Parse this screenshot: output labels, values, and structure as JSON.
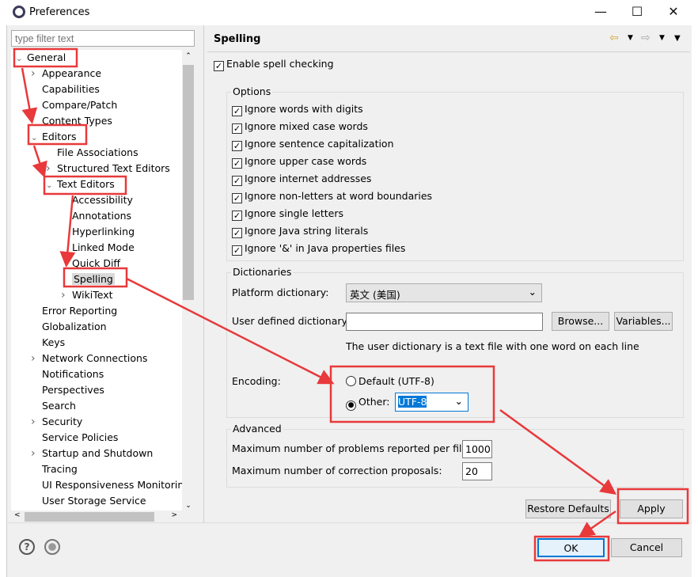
{
  "window": {
    "title": "Preferences",
    "minimize": "—",
    "maximize": "☐",
    "close": "✕"
  },
  "filter": {
    "placeholder": "type filter text"
  },
  "tree": [
    {
      "label": "General",
      "level": 0,
      "twisty": "v"
    },
    {
      "label": "Appearance",
      "level": 1,
      "twisty": ">"
    },
    {
      "label": "Capabilities",
      "level": 1,
      "twisty": ""
    },
    {
      "label": "Compare/Patch",
      "level": 1,
      "twisty": ""
    },
    {
      "label": "Content Types",
      "level": 1,
      "twisty": ""
    },
    {
      "label": "Editors",
      "level": 1,
      "twisty": "v"
    },
    {
      "label": "File Associations",
      "level": 2,
      "twisty": ""
    },
    {
      "label": "Structured Text Editors",
      "level": 2,
      "twisty": ">"
    },
    {
      "label": "Text Editors",
      "level": 2,
      "twisty": "v"
    },
    {
      "label": "Accessibility",
      "level": 3,
      "twisty": ""
    },
    {
      "label": "Annotations",
      "level": 3,
      "twisty": ""
    },
    {
      "label": "Hyperlinking",
      "level": 3,
      "twisty": ""
    },
    {
      "label": "Linked Mode",
      "level": 3,
      "twisty": ""
    },
    {
      "label": "Quick Diff",
      "level": 3,
      "twisty": ""
    },
    {
      "label": "Spelling",
      "level": 3,
      "twisty": "",
      "selected": true
    },
    {
      "label": "WikiText",
      "level": 3,
      "twisty": ">"
    },
    {
      "label": "Error Reporting",
      "level": 1,
      "twisty": ""
    },
    {
      "label": "Globalization",
      "level": 1,
      "twisty": ""
    },
    {
      "label": "Keys",
      "level": 1,
      "twisty": ""
    },
    {
      "label": "Network Connections",
      "level": 1,
      "twisty": ">"
    },
    {
      "label": "Notifications",
      "level": 1,
      "twisty": ""
    },
    {
      "label": "Perspectives",
      "level": 1,
      "twisty": ""
    },
    {
      "label": "Search",
      "level": 1,
      "twisty": ""
    },
    {
      "label": "Security",
      "level": 1,
      "twisty": ">"
    },
    {
      "label": "Service Policies",
      "level": 1,
      "twisty": ""
    },
    {
      "label": "Startup and Shutdown",
      "level": 1,
      "twisty": ">"
    },
    {
      "label": "Tracing",
      "level": 1,
      "twisty": ""
    },
    {
      "label": "UI Responsiveness Monitoring",
      "level": 1,
      "twisty": ""
    },
    {
      "label": "User Storage Service",
      "level": 1,
      "twisty": ""
    }
  ],
  "page": {
    "title": "Spelling",
    "enable": "Enable spell checking",
    "options_title": "Options",
    "options": [
      "Ignore words with digits",
      "Ignore mixed case words",
      "Ignore sentence capitalization",
      "Ignore upper case words",
      "Ignore internet addresses",
      "Ignore non-letters at word boundaries",
      "Ignore single letters",
      "Ignore Java string literals",
      "Ignore '&' in Java properties files"
    ],
    "dict_title": "Dictionaries",
    "platform_label": "Platform dictionary:",
    "platform_value": "英文 (美国)",
    "user_label": "User defined dictionary:",
    "user_value": "",
    "browse": "Browse...",
    "variables": "Variables...",
    "hint": "The user dictionary is a text file with one word on each line",
    "encoding_label": "Encoding:",
    "default_enc": "Default (UTF-8)",
    "other_enc": "Other:",
    "other_value": "UTF-8",
    "adv_title": "Advanced",
    "max_problems_label": "Maximum number of problems reported per file:",
    "max_problems": "1000",
    "max_corr_label": "Maximum number of correction proposals:",
    "max_corr": "20",
    "restore": "Restore Defaults",
    "apply": "Apply"
  },
  "footer": {
    "ok": "OK",
    "cancel": "Cancel",
    "help": "?"
  },
  "annotation_color": "#e8393b"
}
